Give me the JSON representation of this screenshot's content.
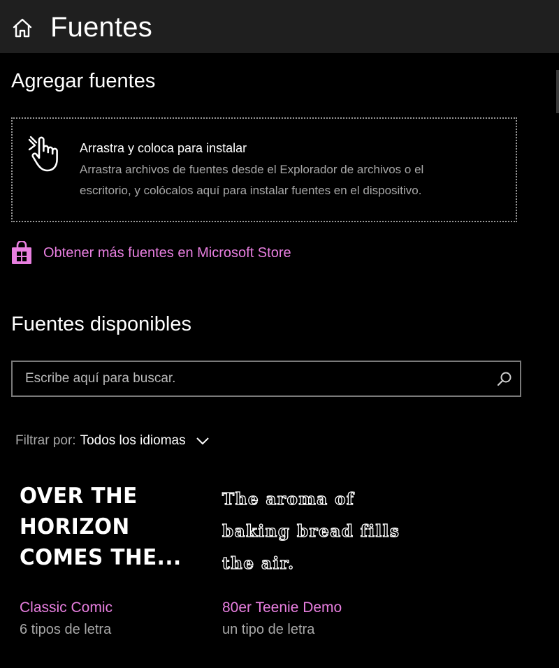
{
  "header": {
    "title": "Fuentes",
    "home_icon": "home-icon"
  },
  "add_fonts": {
    "heading": "Agregar fuentes",
    "dropzone": {
      "icon": "hand-pointer-icon",
      "title": "Arrastra y coloca para instalar",
      "description_line1": "Arrastra archivos de fuentes desde el Explorador de archivos o el",
      "description_line2": "escritorio, y colócalos aquí para instalar fuentes en el dispositivo."
    },
    "store_link": {
      "icon": "store-bag-icon",
      "label": "Obtener más fuentes en Microsoft Store"
    }
  },
  "available_fonts": {
    "heading": "Fuentes disponibles",
    "search": {
      "placeholder": "Escribe aquí para buscar.",
      "value": "",
      "icon": "search-icon"
    },
    "filter": {
      "label": "Filtrar por:",
      "value": "Todos los idiomas",
      "icon": "chevron-down-icon"
    },
    "fonts": [
      {
        "preview": "OVER THE\nHORIZON\nCOMES THE...",
        "name": "Classic Comic",
        "count": "6 tipos de letra"
      },
      {
        "preview": "The aroma of\nbaking bread fills\nthe air.",
        "name": "80er Teenie Demo",
        "count": "un tipo de letra"
      }
    ]
  },
  "colors": {
    "accent": "#e87fe0",
    "background": "#000000",
    "titlebar": "#1f1f1f",
    "secondary_text": "#a8a8a8"
  }
}
